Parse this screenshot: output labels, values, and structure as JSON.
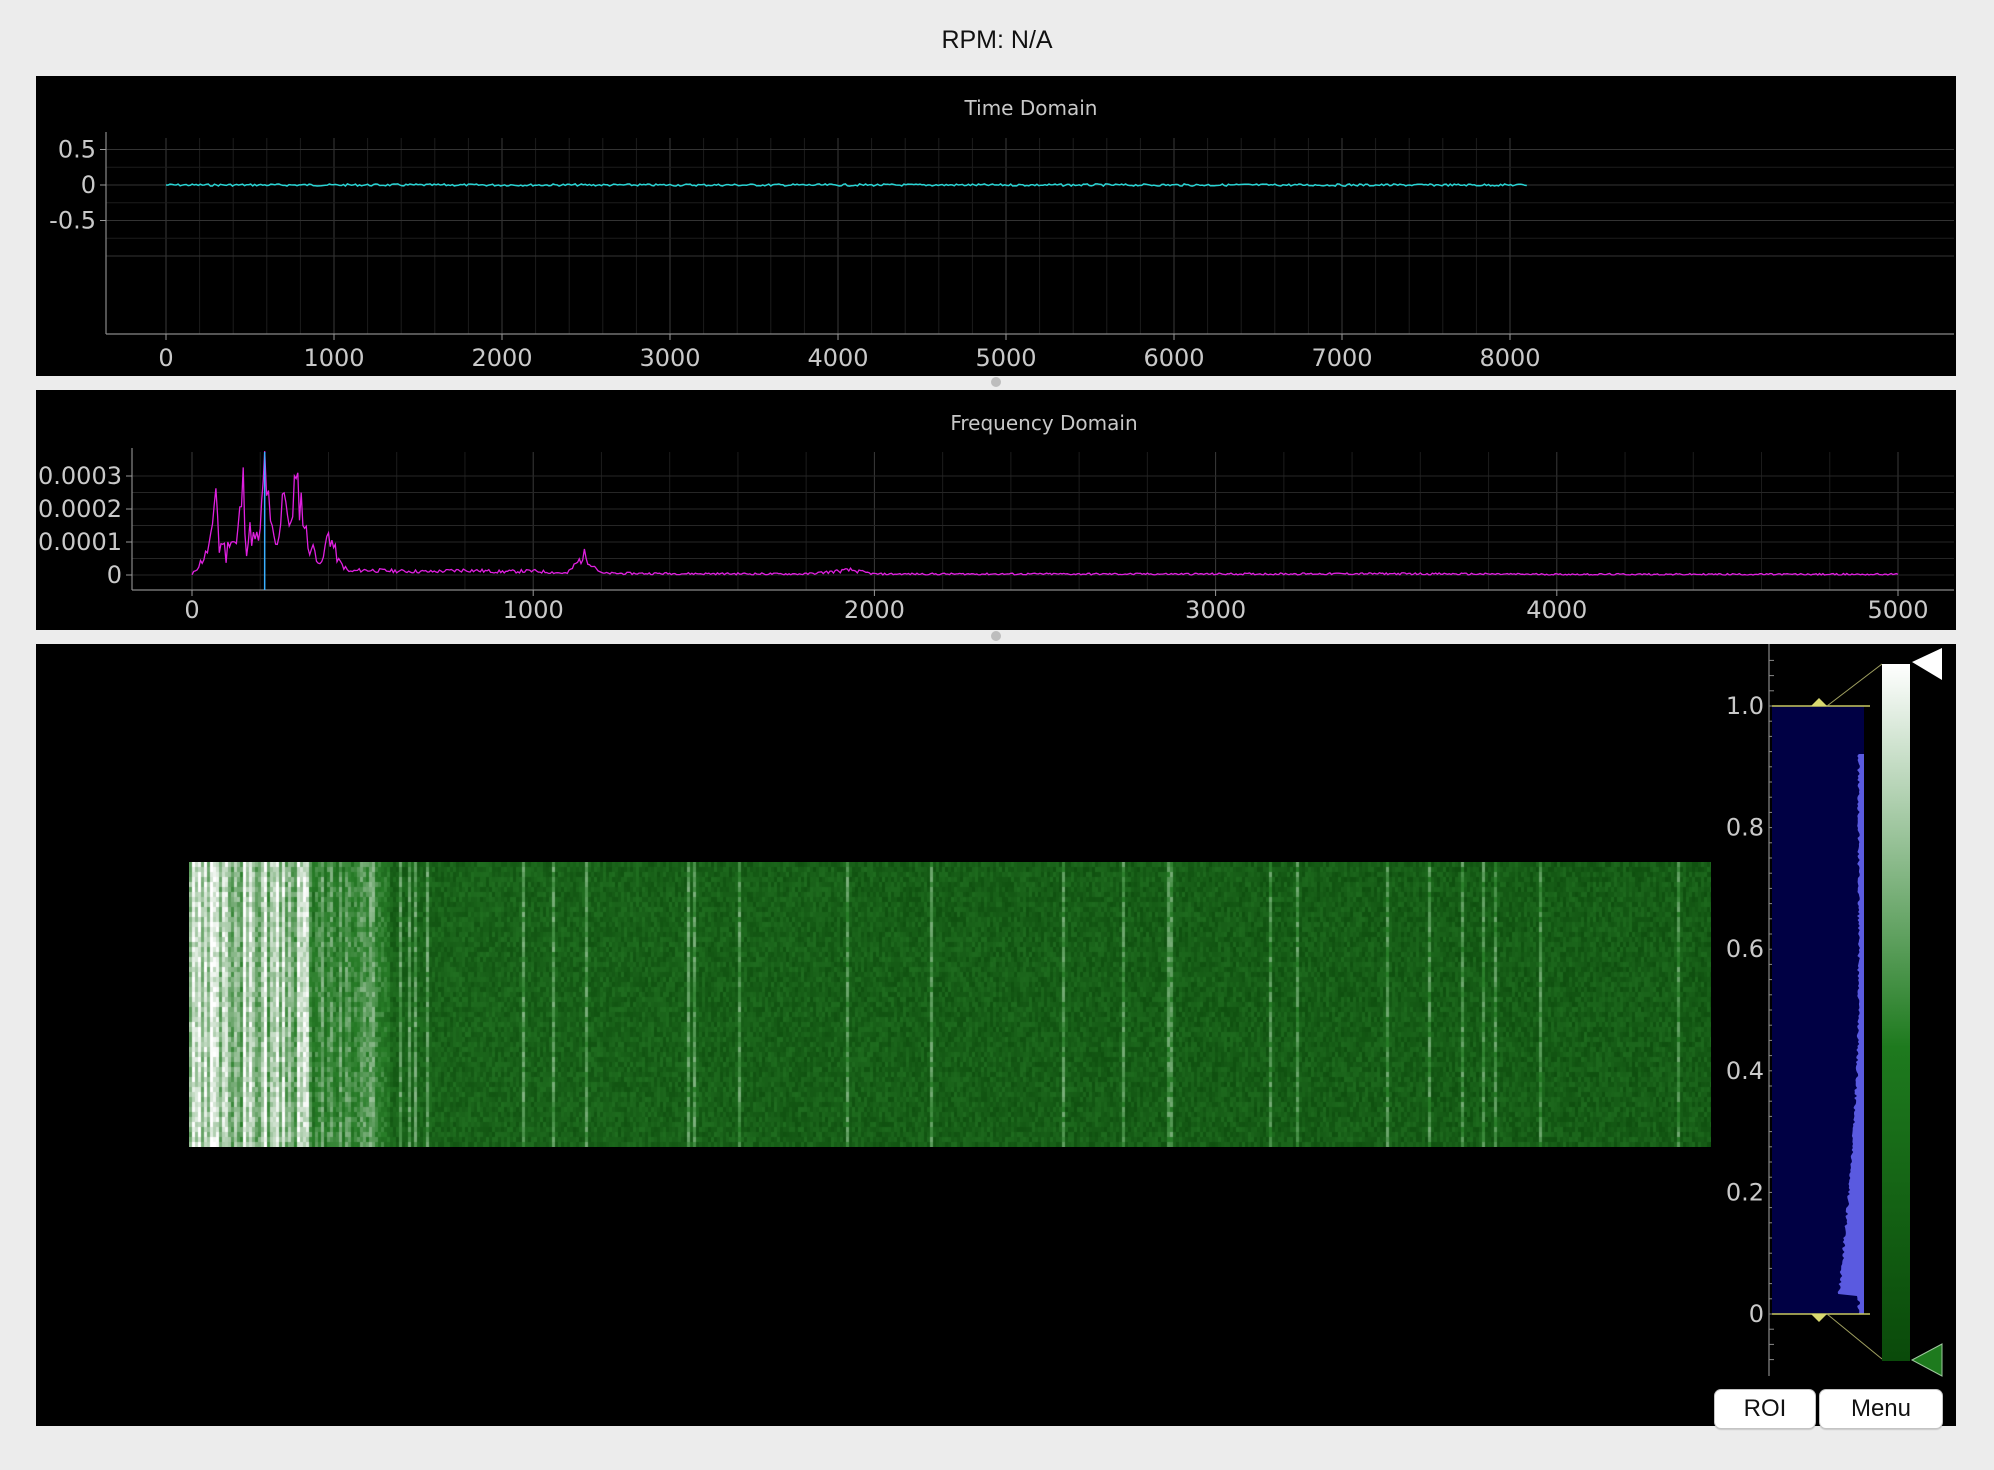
{
  "status": {
    "rpm_text": "RPM: N/A"
  },
  "time_plot": {
    "title": "Time Domain",
    "curve_color": "#2ad4d4",
    "x_ticks": [
      "0",
      "1000",
      "2000",
      "3000",
      "4000",
      "5000",
      "6000",
      "7000",
      "8000"
    ],
    "y_ticks": [
      "0.5",
      "0",
      "-0.5"
    ]
  },
  "freq_plot": {
    "title": "Frequency Domain",
    "curve_color": "#e020e0",
    "marker_color": "#3ab0ff",
    "marker_x": 213,
    "x_ticks": [
      "0",
      "1000",
      "2000",
      "3000",
      "4000",
      "5000"
    ],
    "y_ticks": [
      "0.0003",
      "0.0002",
      "0.0001",
      "0"
    ]
  },
  "spectrogram": {
    "colormap": [
      "#0a4a0a",
      "#1e7a1e",
      "#ffffff"
    ],
    "histogram_ticks": [
      "1.0",
      "0.8",
      "0.6",
      "0.4",
      "0.2",
      "0"
    ],
    "histogram_fill": "#5a5ae0",
    "histogram_bg": "#000044",
    "level_min": 0,
    "level_max": 1.0
  },
  "buttons": {
    "roi": "ROI",
    "menu": "Menu"
  },
  "chart_data": [
    {
      "type": "line",
      "title": "Time Domain",
      "xlabel": "",
      "ylabel": "",
      "xlim": [
        0,
        8100
      ],
      "ylim": [
        -1,
        1
      ],
      "series": [
        {
          "x": [
            0,
            8100
          ],
          "y": [
            0,
            0
          ]
        }
      ]
    },
    {
      "type": "line",
      "title": "Frequency Domain",
      "xlabel": "",
      "ylabel": "",
      "xlim": [
        0,
        5000
      ],
      "ylim": [
        0,
        0.00037
      ],
      "series": [
        {
          "x": [
            0,
            40,
            60,
            70,
            80,
            90,
            100,
            110,
            130,
            150,
            160,
            170,
            185,
            200,
            213,
            230,
            250,
            270,
            285,
            300,
            320,
            340,
            360,
            380,
            400,
            430,
            460,
            500,
            600,
            700,
            800,
            900,
            1000,
            1100,
            1150,
            1200,
            1500,
            1800,
            1930,
            2000,
            2500,
            3000,
            3500,
            4000,
            4500,
            5000
          ],
          "y": [
            0.0,
            6e-05,
            0.00012,
            0.0003,
            7e-05,
            0.00011,
            5e-05,
            0.00012,
            9e-05,
            0.00027,
            8e-05,
            0.00013,
            0.0001,
            0.00012,
            0.00034,
            0.00014,
            8e-05,
            0.0003,
            0.00012,
            0.00027,
            0.00022,
            9e-05,
            7e-05,
            3e-05,
            0.00013,
            4e-05,
            1e-05,
            1.5e-05,
            1.2e-05,
            1e-05,
            1.5e-05,
            1e-05,
            1.2e-05,
            5e-06,
            6e-05,
            5e-06,
            4e-06,
            3e-06,
            1.5e-05,
            3e-06,
            3e-06,
            3e-06,
            4e-06,
            2e-06,
            2e-06,
            2e-06
          ]
        }
      ]
    }
  ]
}
